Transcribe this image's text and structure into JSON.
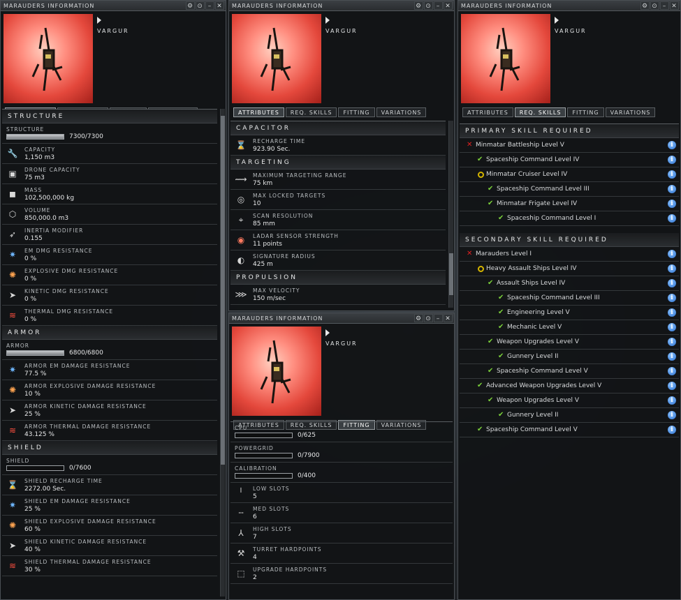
{
  "window_title": "MARAUDERS INFORMATION",
  "ship_name": "VARGUR",
  "title_buttons": [
    "⚙",
    "⊙",
    "–",
    "✕"
  ],
  "tabs": [
    "ATTRIBUTES",
    "REQ. SKILLS",
    "FITTING",
    "VARIATIONS"
  ],
  "attributes": {
    "structure_header": "STRUCTURE",
    "structure_label": "STRUCTURE",
    "structure_value": "7300/7300",
    "structure_fill": 1.0,
    "rows": [
      {
        "label": "CAPACITY",
        "value": "1,150 m3",
        "icon": "capacity-icon"
      },
      {
        "label": "DRONE CAPACITY",
        "value": "75 m3",
        "icon": "drone-capacity-icon"
      },
      {
        "label": "MASS",
        "value": "102,500,000 kg",
        "icon": "mass-icon"
      },
      {
        "label": "VOLUME",
        "value": "850,000.0 m3",
        "icon": "volume-icon"
      },
      {
        "label": "INERTIA MODIFIER",
        "value": "0.155",
        "icon": "inertia-icon"
      },
      {
        "label": "EM DMG RESISTANCE",
        "value": "0 %",
        "icon": "em-resist-icon"
      },
      {
        "label": "EXPLOSIVE DMG RESISTANCE",
        "value": "0 %",
        "icon": "explosive-resist-icon"
      },
      {
        "label": "KINETIC DMG RESISTANCE",
        "value": "0 %",
        "icon": "kinetic-resist-icon"
      },
      {
        "label": "THERMAL DMG RESISTANCE",
        "value": "0 %",
        "icon": "thermal-resist-icon"
      }
    ],
    "armor_header": "ARMOR",
    "armor_label": "ARMOR",
    "armor_value": "6800/6800",
    "armor_fill": 1.0,
    "armor_rows": [
      {
        "label": "ARMOR EM DAMAGE RESISTANCE",
        "value": "77.5 %",
        "icon": "em-resist-icon"
      },
      {
        "label": "ARMOR EXPLOSIVE DAMAGE RESISTANCE",
        "value": "10 %",
        "icon": "explosive-resist-icon"
      },
      {
        "label": "ARMOR KINETIC DAMAGE RESISTANCE",
        "value": "25 %",
        "icon": "kinetic-resist-icon"
      },
      {
        "label": "ARMOR THERMAL DAMAGE RESISTANCE",
        "value": "43.125 %",
        "icon": "thermal-resist-icon"
      }
    ],
    "shield_header": "SHIELD",
    "shield_label": "SHIELD",
    "shield_value": "0/7600",
    "shield_fill": 0.0,
    "shield_rows": [
      {
        "label": "SHIELD RECHARGE TIME",
        "value": "2272.00 Sec.",
        "icon": "hourglass-icon"
      },
      {
        "label": "SHIELD EM DAMAGE RESISTANCE",
        "value": "25 %",
        "icon": "em-resist-icon"
      },
      {
        "label": "SHIELD EXPLOSIVE DAMAGE RESISTANCE",
        "value": "60 %",
        "icon": "explosive-resist-icon"
      },
      {
        "label": "SHIELD KINETIC DAMAGE RESISTANCE",
        "value": "40 %",
        "icon": "kinetic-resist-icon"
      },
      {
        "label": "SHIELD THERMAL DAMAGE RESISTANCE",
        "value": "30 %",
        "icon": "thermal-resist-icon"
      }
    ]
  },
  "attributes2": {
    "capacitor_header": "CAPACITOR",
    "capacitor_rows": [
      {
        "label": "RECHARGE TIME",
        "value": "923.90 Sec.",
        "icon": "hourglass-icon"
      }
    ],
    "targeting_header": "TARGETING",
    "targeting_rows": [
      {
        "label": "MAXIMUM TARGETING RANGE",
        "value": "75 km",
        "icon": "targeting-range-icon"
      },
      {
        "label": "MAX LOCKED TARGETS",
        "value": "10",
        "icon": "locked-targets-icon"
      },
      {
        "label": "SCAN RESOLUTION",
        "value": "85 mm",
        "icon": "scan-resolution-icon"
      },
      {
        "label": "LADAR SENSOR STRENGTH",
        "value": "11 points",
        "icon": "ladar-sensor-icon"
      },
      {
        "label": "SIGNATURE RADIUS",
        "value": "425 m",
        "icon": "signature-radius-icon"
      }
    ],
    "propulsion_header": "PROPULSION",
    "propulsion_rows": [
      {
        "label": "MAX VELOCITY",
        "value": "150 m/sec",
        "icon": "velocity-icon"
      }
    ]
  },
  "fitting": {
    "bars": [
      {
        "label": "CPU",
        "value": "0/625"
      },
      {
        "label": "POWERGRID",
        "value": "0/7900"
      },
      {
        "label": "CALIBRATION",
        "value": "0/400"
      }
    ],
    "rows": [
      {
        "label": "LOW SLOTS",
        "value": "5",
        "icon": "low-slot-icon"
      },
      {
        "label": "MED SLOTS",
        "value": "6",
        "icon": "med-slot-icon"
      },
      {
        "label": "HIGH SLOTS",
        "value": "7",
        "icon": "high-slot-icon"
      },
      {
        "label": "TURRET HARDPOINTS",
        "value": "4",
        "icon": "turret-icon"
      },
      {
        "label": "UPGRADE HARDPOINTS",
        "value": "2",
        "icon": "upgrade-icon"
      }
    ]
  },
  "skills": {
    "primary_header": "PRIMARY SKILL REQUIRED",
    "primary": [
      {
        "name": "Minmatar Battleship Level V",
        "status": "x",
        "depth": 0
      },
      {
        "name": "Spaceship Command Level IV",
        "status": "ok",
        "depth": 1
      },
      {
        "name": "Minmatar Cruiser Level IV",
        "status": "o",
        "depth": 1
      },
      {
        "name": "Spaceship Command Level III",
        "status": "ok",
        "depth": 2
      },
      {
        "name": "Minmatar Frigate Level IV",
        "status": "ok",
        "depth": 2
      },
      {
        "name": "Spaceship Command Level I",
        "status": "ok",
        "depth": 3
      }
    ],
    "secondary_header": "SECONDARY SKILL REQUIRED",
    "secondary": [
      {
        "name": "Marauders Level I",
        "status": "x",
        "depth": 0
      },
      {
        "name": "Heavy Assault Ships Level IV",
        "status": "o",
        "depth": 1
      },
      {
        "name": "Assault Ships Level IV",
        "status": "ok",
        "depth": 2
      },
      {
        "name": "Spaceship Command Level III",
        "status": "ok",
        "depth": 3
      },
      {
        "name": "Engineering Level V",
        "status": "ok",
        "depth": 3
      },
      {
        "name": "Mechanic Level V",
        "status": "ok",
        "depth": 3
      },
      {
        "name": "Weapon Upgrades Level V",
        "status": "ok",
        "depth": 2
      },
      {
        "name": "Gunnery Level II",
        "status": "ok",
        "depth": 3
      },
      {
        "name": "Spaceship Command Level V",
        "status": "ok",
        "depth": 2
      },
      {
        "name": "Advanced Weapon Upgrades Level V",
        "status": "ok",
        "depth": 1
      },
      {
        "name": "Weapon Upgrades Level V",
        "status": "ok",
        "depth": 2
      },
      {
        "name": "Gunnery Level II",
        "status": "ok",
        "depth": 3
      },
      {
        "name": "Spaceship Command Level V",
        "status": "ok",
        "depth": 1
      }
    ]
  }
}
